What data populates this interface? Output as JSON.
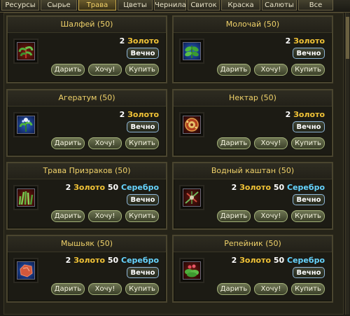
{
  "tabs": [
    {
      "label": "Ресурсы",
      "active": false
    },
    {
      "label": "Сырье",
      "active": false
    },
    {
      "label": "Трава",
      "active": true
    },
    {
      "label": "Цветы",
      "active": false
    },
    {
      "label": "Чернила",
      "active": false
    },
    {
      "label": "Свиток",
      "active": false
    },
    {
      "label": "Краска",
      "active": false
    },
    {
      "label": "Салюты",
      "active": false
    },
    {
      "label": "Все",
      "active": false
    }
  ],
  "currency": {
    "gold": "Золото",
    "silver": "Серебро"
  },
  "duration_label": "Вечно",
  "buttons": {
    "gift": "Дарить",
    "want": "Хочу!",
    "buy": "Купить"
  },
  "items": [
    {
      "title": "Шалфей (50)",
      "gold": "2",
      "silver": "",
      "icon": "sage-herb-icon"
    },
    {
      "title": "Молочай (50)",
      "gold": "2",
      "silver": "",
      "icon": "spurge-herb-icon"
    },
    {
      "title": "Агератум (50)",
      "gold": "2",
      "silver": "",
      "icon": "ageratum-herb-icon"
    },
    {
      "title": "Нектар (50)",
      "gold": "2",
      "silver": "",
      "icon": "nectar-icon"
    },
    {
      "title": "Трава Призраков (50)",
      "gold": "2",
      "silver": "50",
      "icon": "ghost-grass-icon"
    },
    {
      "title": "Водный каштан (50)",
      "gold": "2",
      "silver": "50",
      "icon": "water-chestnut-icon"
    },
    {
      "title": "Мышьяк (50)",
      "gold": "2",
      "silver": "50",
      "icon": "arsenic-icon"
    },
    {
      "title": "Репейник (50)",
      "gold": "2",
      "silver": "50",
      "icon": "burdock-icon"
    }
  ],
  "colors": {
    "gold": "#f2c437",
    "silver": "#66d4ff",
    "title": "#f0d26a"
  }
}
